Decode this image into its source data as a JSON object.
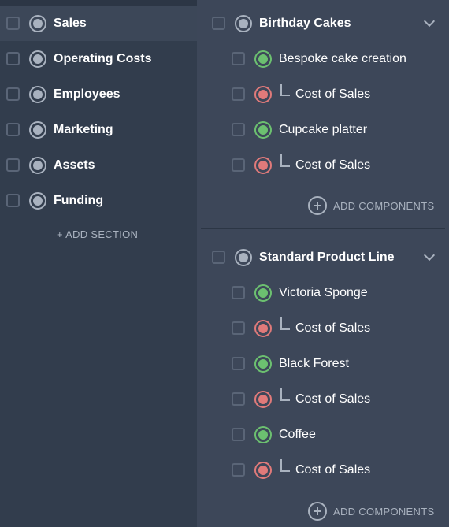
{
  "sidebar": {
    "sections": [
      {
        "label": "Sales",
        "active": true
      },
      {
        "label": "Operating Costs",
        "active": false
      },
      {
        "label": "Employees",
        "active": false
      },
      {
        "label": "Marketing",
        "active": false
      },
      {
        "label": "Assets",
        "active": false
      },
      {
        "label": "Funding",
        "active": false
      }
    ],
    "add_section_label": "+ ADD SECTION"
  },
  "groups": [
    {
      "title": "Birthday Cakes",
      "items": [
        {
          "label": "Bespoke cake creation",
          "sub": "Cost of Sales"
        },
        {
          "label": "Cupcake platter",
          "sub": "Cost of Sales"
        }
      ],
      "add_components_label": "ADD COMPONENTS"
    },
    {
      "title": "Standard Product Line",
      "items": [
        {
          "label": "Victoria Sponge",
          "sub": "Cost of Sales"
        },
        {
          "label": "Black Forest",
          "sub": "Cost of Sales"
        },
        {
          "label": "Coffee",
          "sub": "Cost of Sales"
        }
      ],
      "add_components_label": "ADD COMPONENTS"
    }
  ],
  "colors": {
    "revenue_indicator": "#6cc070",
    "cost_indicator": "#e07a7a",
    "sidebar_bg": "#323d4d",
    "main_bg": "#3d4759"
  },
  "icons": {
    "checkbox": "checkbox-icon",
    "radio": "radio-icon",
    "chevron": "chevron-down-icon",
    "add": "plus-circle-icon"
  }
}
